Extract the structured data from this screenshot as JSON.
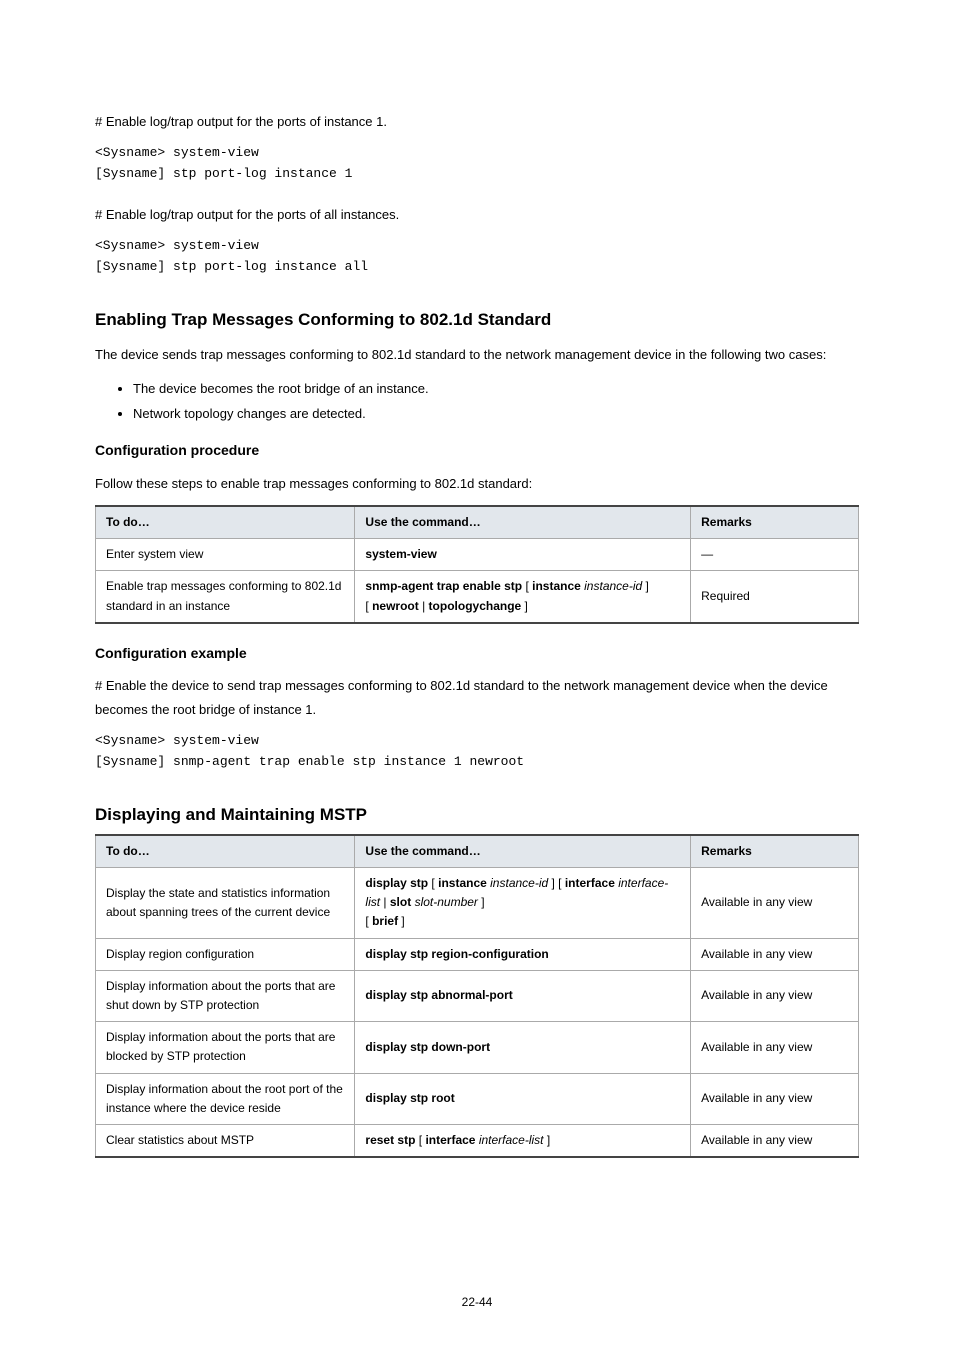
{
  "p_enable_inst1": "# Enable log/trap output for the ports of instance 1.",
  "code_inst1_line1": "<Sysname> system-view",
  "code_inst1_line2": "[Sysname] stp port-log instance 1",
  "p_enable_all": "# Enable log/trap output for the ports of all instances.",
  "code_all_line1": "<Sysname> system-view",
  "code_all_line2": "[Sysname] stp port-log instance all",
  "h_trap": "Enabling Trap Messages Conforming to 802.1d Standard",
  "p_trap_intro_1": "The device sends trap messages conforming to 802.1d standard to the network management device in the following two cases:",
  "trap_bullets": [
    "The device becomes the root bridge of an instance.",
    "Network topology changes are detected."
  ],
  "h_trap_cfg": "Configuration procedure",
  "p_trap_follow": "Follow these steps to enable trap messages conforming to 802.1d standard:",
  "trap_table": {
    "headers": [
      "To do…",
      "Use the command…",
      "Remarks"
    ],
    "rows": [
      {
        "todo": "Enter system view",
        "cmd": {
          "bold": "system-view",
          "args": ""
        },
        "remarks": "—"
      },
      {
        "todo": "Enable trap messages conforming to 802.1d standard in an instance",
        "cmd_html": true,
        "cmd_parts": {
          "pre": "snmp-agent trap enable stp ",
          "lb1": "[ ",
          "b1": "instance",
          "sp1": " ",
          "i1": "instance-id",
          "rb1": " ]",
          "bar": "\n[ ",
          "b2": "newroot",
          "mid": " | ",
          "b3": "topologychange",
          "rb2": " ]"
        },
        "remarks": "Required"
      }
    ]
  },
  "h_trap_ex": "Configuration example",
  "p_trap_ex_1": "# Enable the device to send trap messages conforming to 802.1d standard to the network management device when the device becomes the root bridge of instance 1.",
  "code_trap_ex_1": "<Sysname> system-view",
  "code_trap_ex_2": "[Sysname] snmp-agent trap enable stp instance 1 newroot",
  "h_display": "Displaying and Maintaining MSTP",
  "disp_table": {
    "headers": [
      "To do…",
      "Use the command…",
      "Remarks"
    ],
    "rows": [
      {
        "todo": "Display the state and statistics information about spanning trees of the current device",
        "cmd_parts": {
          "b0": "display stp",
          "sp": " [ ",
          "b1": "instance",
          "sp1": " ",
          "i1": "instance-id",
          "rb1": " ] [ ",
          "b2": "interface",
          "sp2": " ",
          "i2": "interface-list",
          "bar": " | ",
          "b3": "slot",
          "sp3": " ",
          "i3": "slot-number",
          "rb2": " ]\n[ ",
          "b4": "brief",
          "rb3": " ]"
        },
        "remarks": "Available in any view"
      },
      {
        "todo": "Display region configuration",
        "cmd": {
          "bold": "display stp region-configuration"
        },
        "remarks": "Available in any view"
      },
      {
        "todo": "Display information about the ports that are shut down by STP protection",
        "cmd": {
          "bold": "display stp abnormal-port"
        },
        "remarks": "Available in any view"
      },
      {
        "todo": "Display information about the ports that are blocked by STP protection",
        "cmd": {
          "bold": "display stp down-port"
        },
        "remarks": "Available in any view"
      },
      {
        "todo": "Display information about the root port of the instance where the device reside",
        "cmd": {
          "bold": "display stp root"
        },
        "remarks": "Available in any view"
      },
      {
        "todo": "Clear statistics about MSTP",
        "cmd_parts": {
          "b0": "reset stp",
          "lb": " [ ",
          "b1": "interface",
          "sp": " ",
          "i1": "interface-list",
          "rb": " ]"
        },
        "remarks": "Available in any view"
      }
    ]
  },
  "footer": "22-44"
}
